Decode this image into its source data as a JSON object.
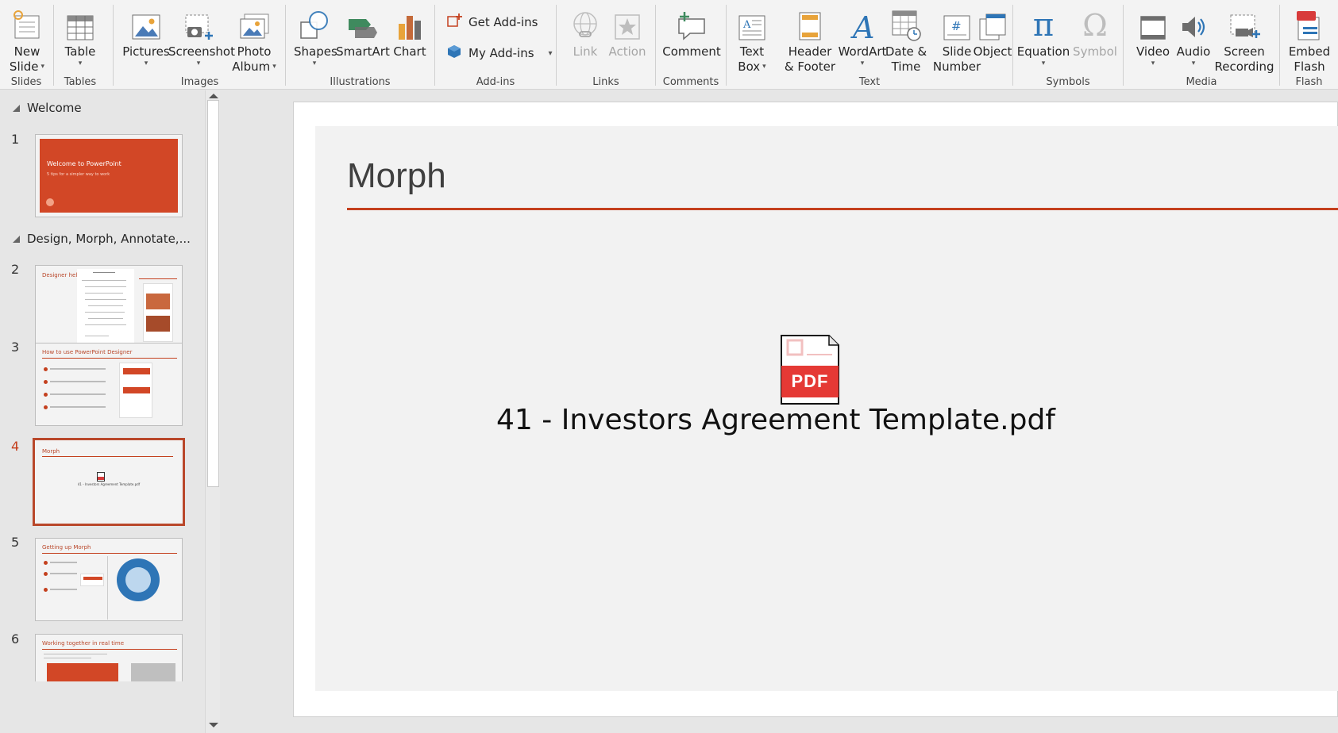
{
  "ribbon": {
    "groups": {
      "slides": "Slides",
      "tables": "Tables",
      "images": "Images",
      "illustrations": "Illustrations",
      "addins": "Add-ins",
      "links": "Links",
      "comments": "Comments",
      "text": "Text",
      "symbols": "Symbols",
      "media": "Media",
      "flash": "Flash"
    },
    "buttons": {
      "new_slide_1": "New",
      "new_slide_2": "Slide",
      "table": "Table",
      "pictures": "Pictures",
      "screenshot": "Screenshot",
      "photo_album_1": "Photo",
      "photo_album_2": "Album",
      "shapes": "Shapes",
      "smartart": "SmartArt",
      "chart": "Chart",
      "get_addins": "Get Add-ins",
      "my_addins": "My Add-ins",
      "link": "Link",
      "action": "Action",
      "comment": "Comment",
      "text_box_1": "Text",
      "text_box_2": "Box",
      "header_footer_1": "Header",
      "header_footer_2": "& Footer",
      "wordart": "WordArt",
      "date_time_1": "Date &",
      "date_time_2": "Time",
      "slide_number_1": "Slide",
      "slide_number_2": "Number",
      "object": "Object",
      "equation": "Equation",
      "symbol": "Symbol",
      "video": "Video",
      "audio": "Audio",
      "screen_recording_1": "Screen",
      "screen_recording_2": "Recording",
      "embed_flash_1": "Embed",
      "embed_flash_2": "Flash"
    }
  },
  "thumbnails": {
    "sections": [
      "Welcome",
      "Design, Morph, Annotate,..."
    ],
    "slides": [
      {
        "number": "1",
        "title": "Welcome to PowerPoint",
        "subtitle": "5 tips for a simpler way to work"
      },
      {
        "number": "2",
        "title": "Designer helps you"
      },
      {
        "number": "3",
        "title": "How to use PowerPoint Designer"
      },
      {
        "number": "4",
        "title": "Morph",
        "caption": "41 - Investors Agreement Template.pdf"
      },
      {
        "number": "5",
        "title": "Getting up Morph"
      },
      {
        "number": "6",
        "title": "Working together in real time"
      }
    ],
    "active_slide": 4
  },
  "slide": {
    "title": "Morph",
    "pdf_badge": "PDF",
    "file_name": "41 - Investors Agreement Template.pdf"
  },
  "colors": {
    "accent": "#c4401e",
    "ribbon_bg": "#f3f3f3",
    "slide_bg": "#f2f2f2"
  }
}
